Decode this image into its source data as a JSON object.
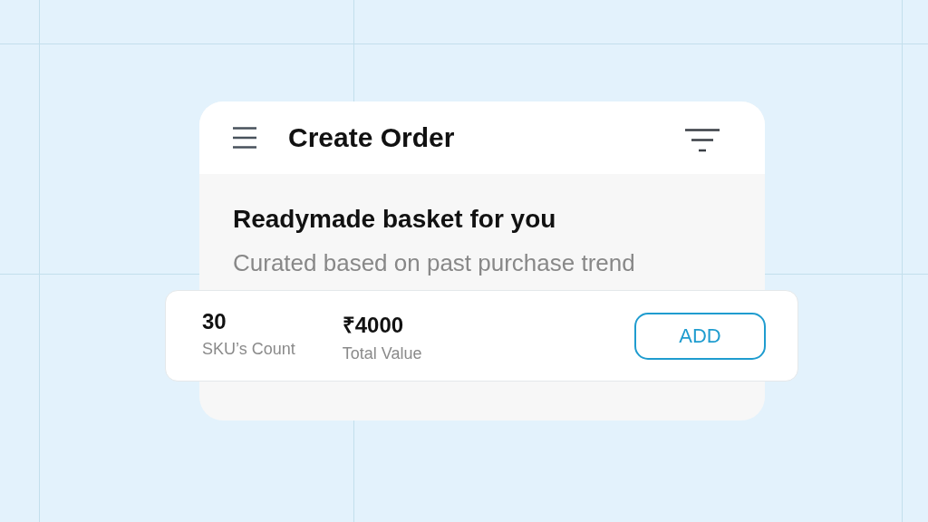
{
  "header": {
    "title": "Create Order"
  },
  "basket": {
    "title": "Readymade basket for you",
    "subtitle": "Curated based on past purchase trend"
  },
  "summary": {
    "stats": [
      {
        "value": "30",
        "label": "SKU’s Count"
      },
      {
        "value": "₹4000",
        "label": "Total Value"
      }
    ],
    "button": "ADD"
  }
}
